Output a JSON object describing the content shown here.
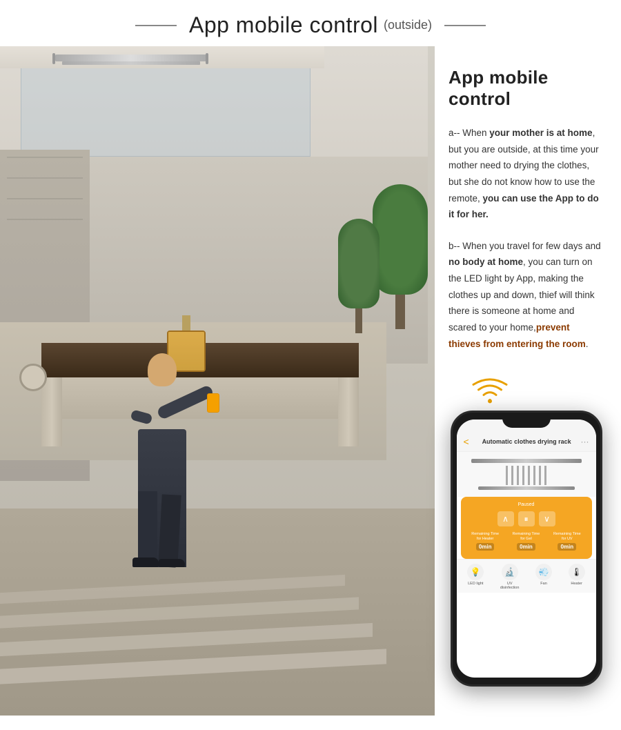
{
  "header": {
    "title_main": "App mobile control",
    "title_sub": "(outside)"
  },
  "panel": {
    "title": "App mobile control",
    "paragraph_a_prefix": "a-- When ",
    "paragraph_a_bold1": "your mother is at home",
    "paragraph_a_middle": ", but you are outside, at this time your mother need to drying the clothes, but she do not know how to use the remote, ",
    "paragraph_a_bold2": "you can use the App to do it for her.",
    "paragraph_b_prefix": "b-- When you travel for few days and ",
    "paragraph_b_bold1": "no body at home",
    "paragraph_b_middle": ", you can turn on the LED light by App, making the clothes up and down, thief will think there is someone at home and scared to your home,",
    "paragraph_b_bold2": "prevent thieves from entering the room",
    "paragraph_b_end": "."
  },
  "phone": {
    "header_title": "Automatic clothes drying rack",
    "status_text": "Paused",
    "timer1_label": "Remaining Time\nfor Heater",
    "timer1_value": "0min",
    "timer2_label": "Remaining Time\nfor Gel",
    "timer2_value": "0min",
    "timer3_label": "Remaining Time\nfor UV",
    "timer3_value": "0min",
    "icon1_label": "LED light",
    "icon2_label": "UV\ndisinfection",
    "icon3_label": "Fan",
    "icon4_label": "Heater"
  },
  "icons": {
    "up_arrow": "∧",
    "pause": "⏸",
    "down_arrow": "∨",
    "led": "💡",
    "uv": "🔬",
    "fan": "💨",
    "heater": "🌡"
  }
}
